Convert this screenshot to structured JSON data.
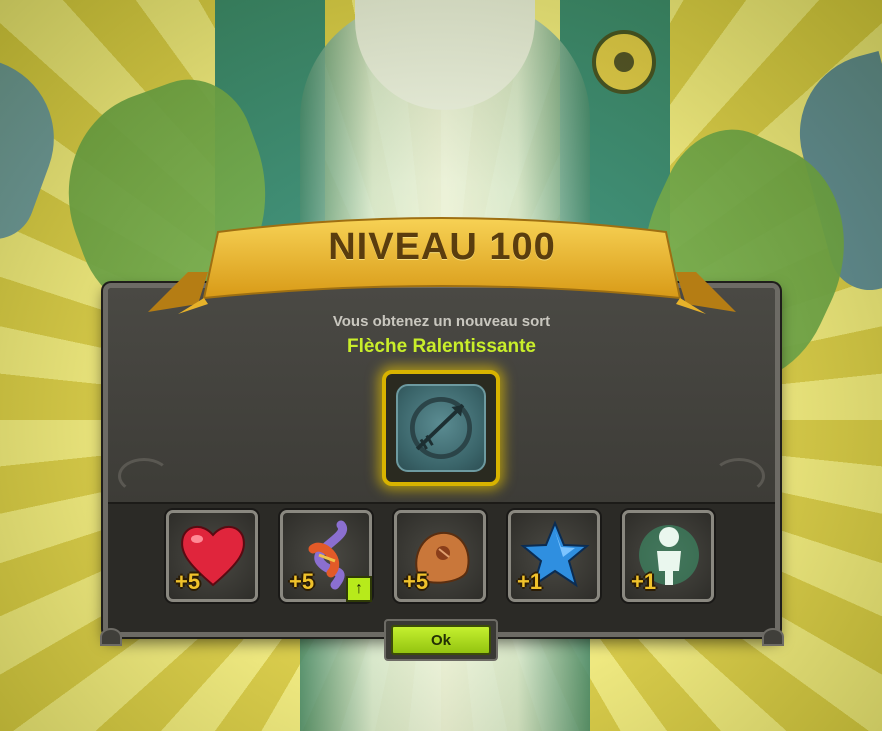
{
  "popup": {
    "title": "NIVEAU 100",
    "subtitle": "Vous obtenez un nouveau sort",
    "spell_name": "Flèche Ralentissante",
    "spell_icon": "arrow-spell-icon",
    "ok_label": "Ok"
  },
  "rewards": [
    {
      "icon": "heart-icon",
      "value": "+5"
    },
    {
      "icon": "dna-icon",
      "value": "+5",
      "badge": "↑"
    },
    {
      "icon": "rock-fist-icon",
      "value": "+5"
    },
    {
      "icon": "star-icon",
      "value": "+1"
    },
    {
      "icon": "character-icon",
      "value": "+1"
    }
  ],
  "colors": {
    "accent_green": "#c9ee2a",
    "banner_gold": "#e9b92a",
    "reward_text": "#f0c22b"
  }
}
